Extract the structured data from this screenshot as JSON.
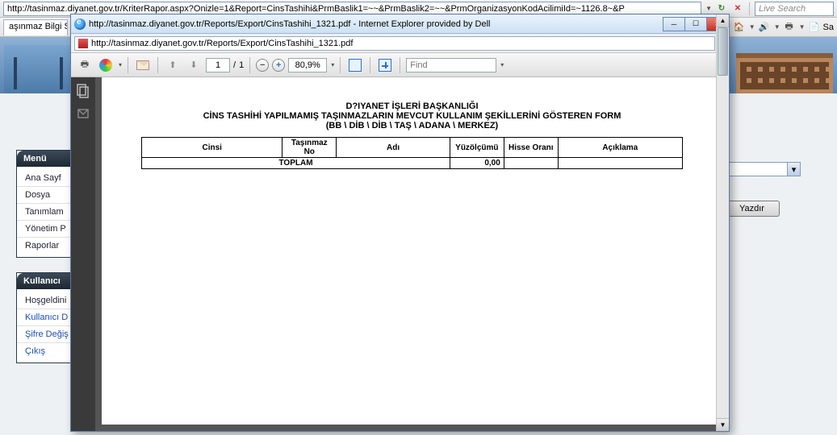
{
  "browser": {
    "url": "http://tasinmaz.diyanet.gov.tr/KriterRapor.aspx?Onizle=1&Report=CinsTashihi&PrmBaslik1=~~&PrmBaslik2=~~&PrmOrganizasyonKodAcilimiId=~1126.8~&P",
    "search_placeholder": "Live Search"
  },
  "tab_label": "aşınmaz Bilgi Sis",
  "toolbar_sa": "Sa",
  "left_menu": {
    "title": "Menü",
    "items": [
      "Ana Sayf",
      "Dosya",
      "Tanımlam",
      "Yönetim P",
      "Raporlar"
    ]
  },
  "user_panel": {
    "title": "Kullanıcı",
    "welcome": "Hoşgeldini",
    "items": [
      "Kullanıcı D",
      "Şifre Değiş",
      "Çıkış"
    ]
  },
  "right": {
    "print_btn": "Yazdır"
  },
  "popup": {
    "title": "http://tasinmaz.diyanet.gov.tr/Reports/Export/CinsTashihi_1321.pdf - Internet Explorer provided by Dell",
    "url": "http://tasinmaz.diyanet.gov.tr/Reports/Export/CinsTashihi_1321.pdf"
  },
  "pdf": {
    "page_current": "1",
    "page_sep": "/",
    "page_total": "1",
    "zoom": "80,9%",
    "find_placeholder": "Find"
  },
  "report": {
    "h1": "D?IYANET İŞLERİ BAŞKANLIĞI",
    "h2": "CİNS TASHİHİ YAPILMAMIŞ TAŞINMAZLARIN MEVCUT KULLANIM ŞEKİLLERİNİ GÖSTEREN FORM",
    "h3": "(BB \\ DİB \\ DİB \\ TAŞ \\ ADANA   \\ MERKEZ)",
    "cols": [
      "Cinsi",
      "Taşınmaz No",
      "Adı",
      "Yüzölçümü",
      "Hisse Oranı",
      "Açıklama"
    ],
    "total_label": "TOPLAM",
    "total_value": "0,00"
  }
}
